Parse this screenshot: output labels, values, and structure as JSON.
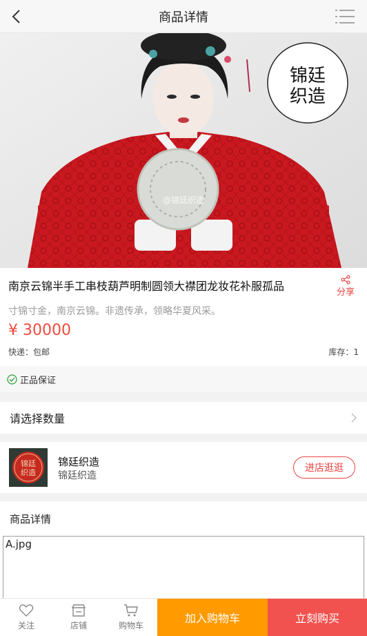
{
  "header": {
    "title": "商品详情",
    "back_icon": "chevron-left-icon",
    "menu_icon": "list-menu-icon"
  },
  "hero": {
    "watermark": "@锦廷织造",
    "brand_seal_text": "锦廷织造"
  },
  "product": {
    "name": "南京云锦半手工串枝葫芦明制圆领大襟团龙妆花补服孤品",
    "share_label": "分享",
    "subtitle": "寸锦寸金，南京云锦。非遗传承，领略华夏风采。",
    "price": "¥ 30000",
    "shipping": "快递：包邮",
    "stock": "库存：1"
  },
  "guarantee": {
    "label": "正品保证"
  },
  "quantity": {
    "label": "请选择数量"
  },
  "shop": {
    "name": "锦廷织造",
    "subtitle": "锦廷织造",
    "visit_label": "进店逛逛"
  },
  "details": {
    "heading": "商品详情",
    "image_alt": "A.jpg"
  },
  "bottom_bar": {
    "follow_label": "关注",
    "store_label": "店铺",
    "cart_label": "购物车",
    "add_to_cart": "加入购物车",
    "buy_now": "立刻购买"
  },
  "colors": {
    "accent_red": "#e94440",
    "price_red": "#f04a3d",
    "orange": "#ff9a00",
    "buy_red": "#f2524f"
  }
}
